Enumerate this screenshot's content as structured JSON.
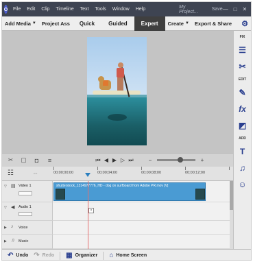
{
  "titlebar": {
    "menus": [
      "File",
      "Edit",
      "Clip",
      "Timeline",
      "Text",
      "Tools",
      "Window",
      "Help"
    ],
    "project": "My Project...",
    "save": "Save",
    "controls": {
      "minimize": "—",
      "maximize": "□",
      "close": "✕"
    }
  },
  "modebar": {
    "add_media": "Add Media",
    "project_assets": "Project Ass",
    "tabs": [
      "Quick",
      "Guided",
      "Expert"
    ],
    "active_tab": "Expert",
    "create": "Create",
    "export_share": "Export & Share"
  },
  "rpanel": {
    "fix_label": "FIX",
    "edit_label": "EDIT",
    "add_label": "ADD"
  },
  "timeline": {
    "timecodes": [
      "00;00;00;00",
      "00;00;04;00",
      "00;00;08;00",
      "00;00;12;00",
      "00;00;16;00"
    ],
    "tracks": {
      "video1": "Video 1",
      "audio1": "Audio 1",
      "voice": "Voice",
      "music": "Music"
    },
    "clip_name": "shutterstock_1314977776_HD - dog on surfboard from Adobe PR.mov [V]"
  },
  "bottombar": {
    "undo": "Undo",
    "redo": "Redo",
    "organizer": "Organizer",
    "home": "Home Screen"
  },
  "colors": {
    "accent": "#2a3f8f",
    "clip": "#4a9bd3",
    "playhead": "#2b7fbf"
  }
}
